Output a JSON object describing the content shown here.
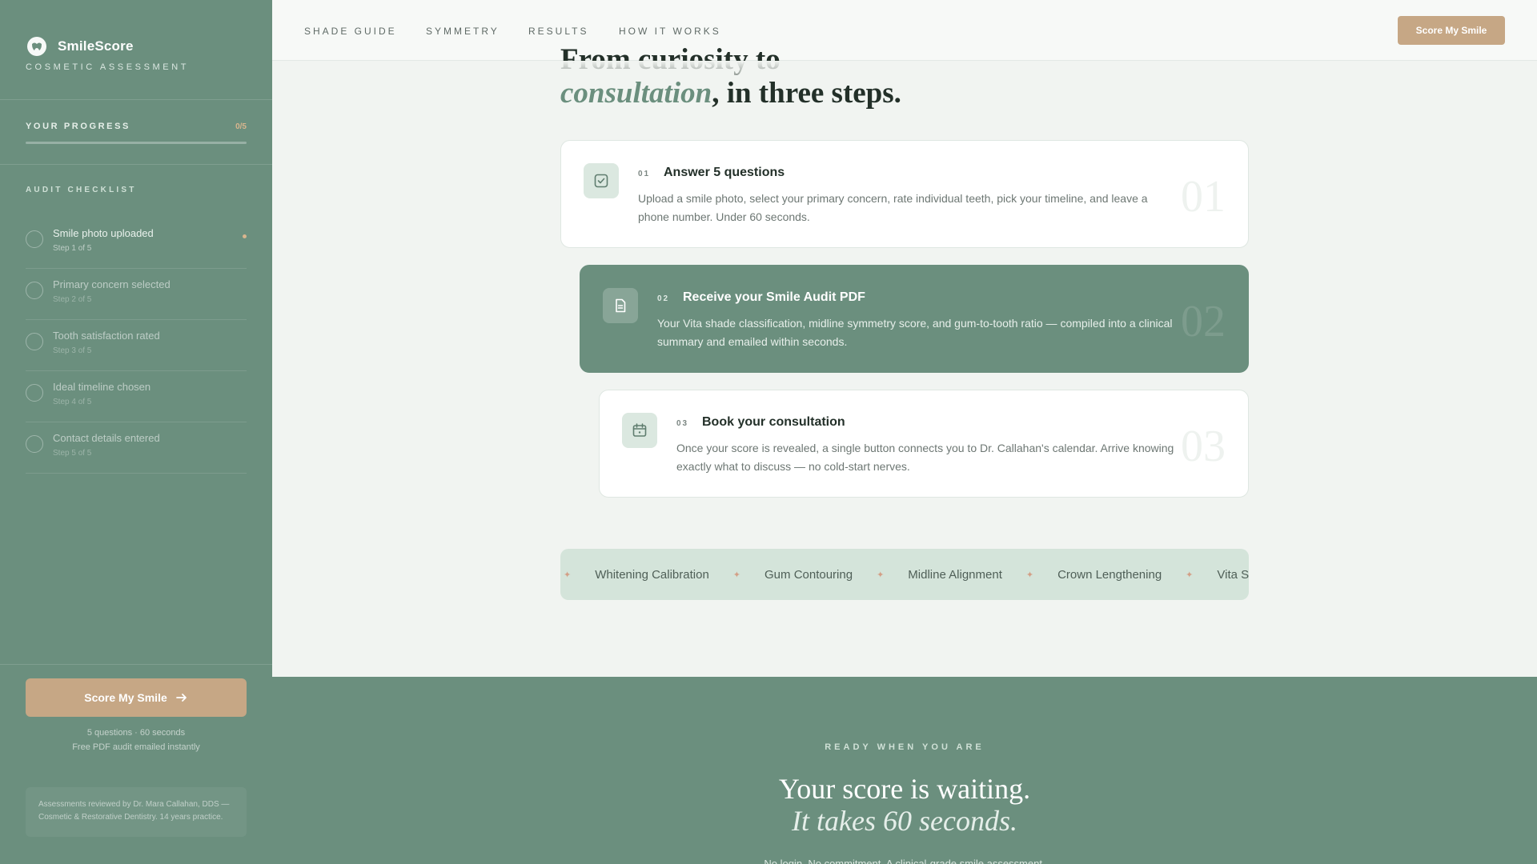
{
  "sidebar": {
    "brand": "SmileScore",
    "brand_sub": "COSMETIC ASSESSMENT",
    "progress_label": "YOUR PROGRESS",
    "progress_count": "0/5",
    "progress_fraction": 0,
    "checklist_label": "AUDIT CHECKLIST",
    "items": [
      {
        "title": "Smile photo uploaded",
        "step": "Step 1 of 5"
      },
      {
        "title": "Primary concern selected",
        "step": "Step 2 of 5"
      },
      {
        "title": "Tooth satisfaction rated",
        "step": "Step 3 of 5"
      },
      {
        "title": "Ideal timeline chosen",
        "step": "Step 4 of 5"
      },
      {
        "title": "Contact details entered",
        "step": "Step 5 of 5"
      }
    ],
    "cta_label": "Score My Smile",
    "note1": "5 questions · 60 seconds",
    "note2": "Free PDF audit emailed instantly",
    "reviewer_note": "Assessments reviewed by Dr. Mara Callahan, DDS — Cosmetic & Restorative Dentistry. 14 years practice."
  },
  "nav": {
    "links": [
      "SHADE GUIDE",
      "SYMMETRY",
      "RESULTS",
      "HOW IT WORKS"
    ],
    "cta_label": "Score My Smile"
  },
  "heading": {
    "line1": "From curiosity to",
    "emph": "consultation",
    "rest": ", in three steps."
  },
  "steps": [
    {
      "num": "01",
      "title": "Answer 5 questions",
      "desc": "Upload a smile photo, select your primary concern, rate individual teeth, pick your timeline, and leave a phone number. Under 60 seconds.",
      "big": "01",
      "icon": "checkbox-icon"
    },
    {
      "num": "02",
      "title": "Receive your Smile Audit PDF",
      "desc": "Your Vita shade classification, midline symmetry score, and gum-to-tooth ratio — compiled into a clinical summary and emailed within seconds.",
      "big": "02",
      "icon": "document-icon"
    },
    {
      "num": "03",
      "title": "Book your consultation",
      "desc": "Once your score is revealed, a single button connects you to Dr. Callahan's calendar. Arrive knowing exactly what to discuss — no cold-start nerves.",
      "big": "03",
      "icon": "calendar-icon"
    }
  ],
  "ticker": [
    "Whitening Calibration",
    "Gum Contouring",
    "Midline Alignment",
    "Crown Lengthening",
    "Vita Shade"
  ],
  "band": {
    "kicker": "READY WHEN YOU ARE",
    "title": "Your score is waiting.",
    "title2": "It takes 60 seconds.",
    "sub": "No login. No commitment. A clinical-grade smile assessment."
  },
  "colors": {
    "sage": "#6b8f7e",
    "sand": "#c6a785",
    "accent_dot": "#d8b58e"
  }
}
